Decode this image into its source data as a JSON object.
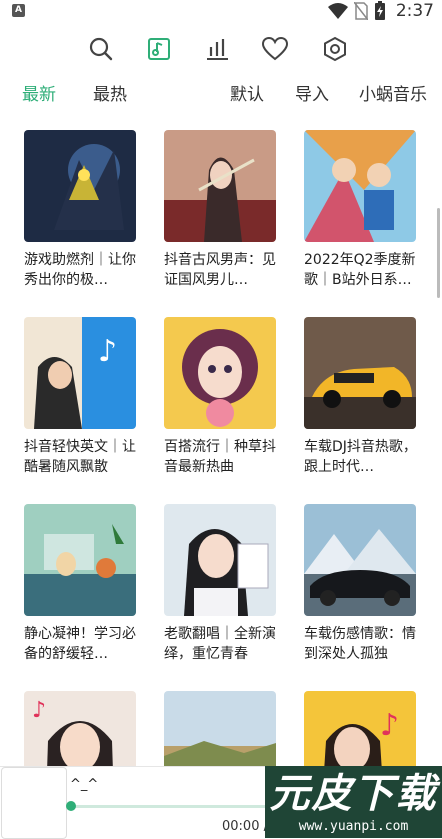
{
  "status": {
    "time": "2:37",
    "app_badge": "A"
  },
  "toolbar": {
    "icons": [
      "search-icon",
      "music-library-icon",
      "chart-icon",
      "heart-icon",
      "settings-icon"
    ],
    "accent": "#2fae78"
  },
  "tabs": [
    "最新",
    "最热",
    "默认",
    "导入",
    "小蜗音乐"
  ],
  "playlists": [
    {
      "title": "游戏助燃剂｜让你秀出你的极…"
    },
    {
      "title": "抖音古风男声：见证国风男儿…"
    },
    {
      "title": "2022年Q2季度新歌｜B站外日系…"
    },
    {
      "title": "抖音轻快英文｜让酷暑随风飘散"
    },
    {
      "title": "百搭流行｜种草抖音最新热曲"
    },
    {
      "title": "车载DJ抖音热歌，跟上时代…"
    },
    {
      "title": "静心凝神！学习必备的舒缓轻…"
    },
    {
      "title": "老歌翻唱｜全新演绎，重忆青春"
    },
    {
      "title": "车载伤感情歌：情到深处人孤独"
    },
    {
      "title": ""
    },
    {
      "title": ""
    },
    {
      "title": ""
    }
  ],
  "player": {
    "title": "^_^",
    "time": "00:00 / 00:00",
    "progress": 0
  },
  "watermark": {
    "big": "元皮下载",
    "url": "www.yuanpi.com"
  }
}
